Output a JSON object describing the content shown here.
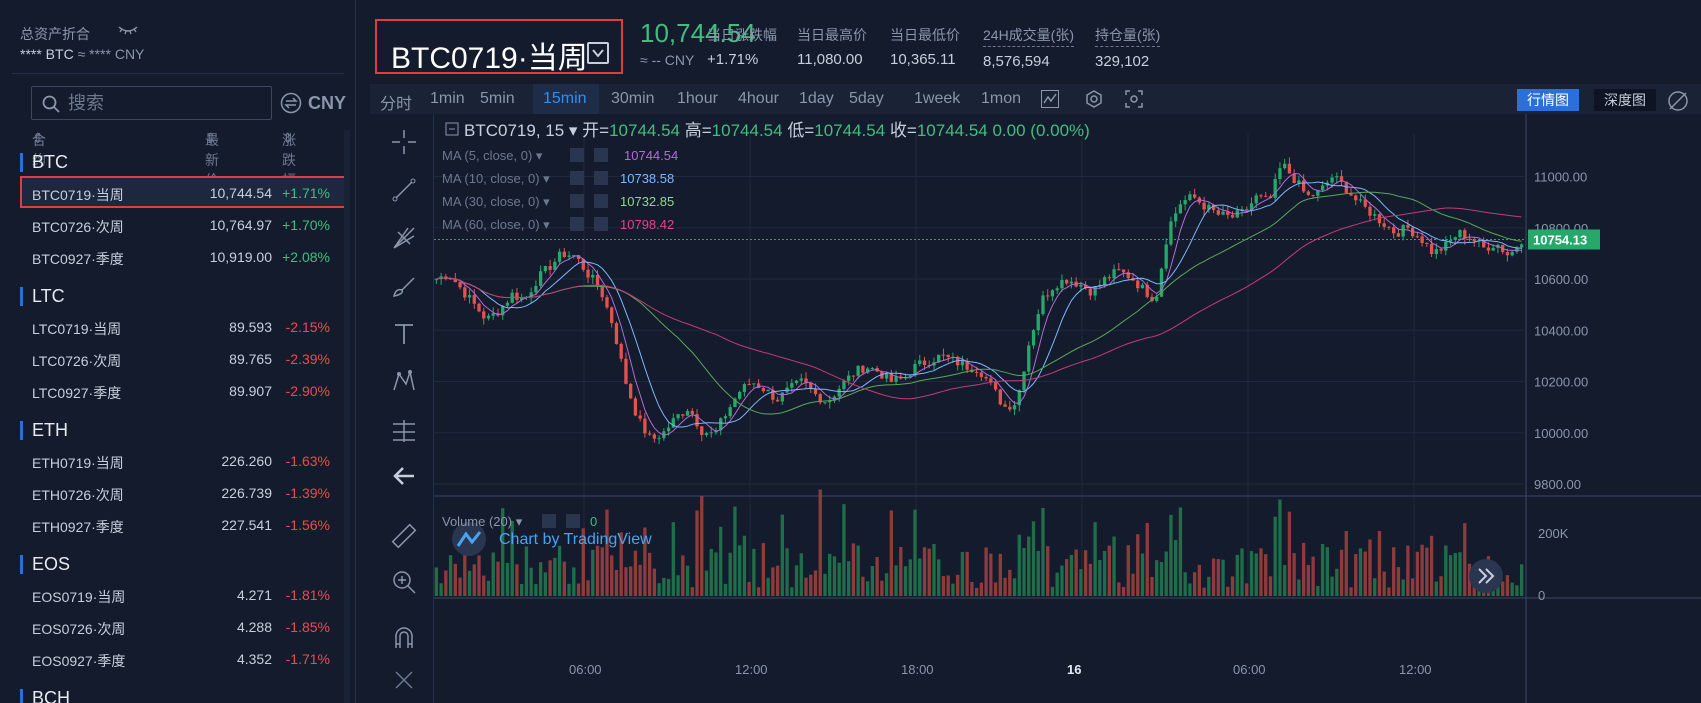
{
  "sidebar": {
    "asset_title": "总资产折合",
    "asset_btc": "**** BTC",
    "asset_cny": "≈ **** CNY",
    "search_placeholder": "搜索",
    "currency": "CNY",
    "col_contract": "合约",
    "col_price": "最新价",
    "col_change": "涨跌幅",
    "groups": [
      {
        "title": "BTC",
        "rows": [
          {
            "name": "BTC0719·当周",
            "price": "10,744.54",
            "change": "+1.71%",
            "dir": "up",
            "selected": true
          },
          {
            "name": "BTC0726·次周",
            "price": "10,764.97",
            "change": "+1.70%",
            "dir": "up"
          },
          {
            "name": "BTC0927·季度",
            "price": "10,919.00",
            "change": "+2.08%",
            "dir": "up"
          }
        ]
      },
      {
        "title": "LTC",
        "rows": [
          {
            "name": "LTC0719·当周",
            "price": "89.593",
            "change": "-2.15%",
            "dir": "down"
          },
          {
            "name": "LTC0726·次周",
            "price": "89.765",
            "change": "-2.39%",
            "dir": "down"
          },
          {
            "name": "LTC0927·季度",
            "price": "89.907",
            "change": "-2.90%",
            "dir": "down"
          }
        ]
      },
      {
        "title": "ETH",
        "rows": [
          {
            "name": "ETH0719·当周",
            "price": "226.260",
            "change": "-1.63%",
            "dir": "down"
          },
          {
            "name": "ETH0726·次周",
            "price": "226.739",
            "change": "-1.39%",
            "dir": "down"
          },
          {
            "name": "ETH0927·季度",
            "price": "227.541",
            "change": "-1.56%",
            "dir": "down"
          }
        ]
      },
      {
        "title": "EOS",
        "rows": [
          {
            "name": "EOS0719·当周",
            "price": "4.271",
            "change": "-1.81%",
            "dir": "down"
          },
          {
            "name": "EOS0726·次周",
            "price": "4.288",
            "change": "-1.85%",
            "dir": "down"
          },
          {
            "name": "EOS0927·季度",
            "price": "4.352",
            "change": "-1.71%",
            "dir": "down"
          }
        ]
      },
      {
        "title": "BCH",
        "rows": []
      }
    ]
  },
  "header": {
    "symbol": "BTC0719·当周",
    "last_price": "10,744.54",
    "last_cny": "≈ -- CNY",
    "stats": [
      {
        "key": "当日涨跌幅",
        "value": "+1.71%",
        "dir": "up"
      },
      {
        "key": "当日最高价",
        "value": "11,080.00"
      },
      {
        "key": "当日最低价",
        "value": "10,365.11"
      },
      {
        "key": "24H成交量(张)",
        "value": "8,576,594",
        "dashed": true
      },
      {
        "key": "持仓量(张)",
        "value": "329,102",
        "dashed": true
      }
    ]
  },
  "toolbar": {
    "timeframes": [
      "分时",
      "1min",
      "5min",
      "15min",
      "30min",
      "1hour",
      "4hour",
      "1day",
      "5day",
      "1week",
      "1mon"
    ],
    "active_timeframe": "15min",
    "market_btn": "行情图",
    "depth_btn": "深度图"
  },
  "chart": {
    "legend_symbol": "BTC0719, 15",
    "ohlc": {
      "open_label": "开=",
      "open": "10744.54",
      "high_label": "高=",
      "high": "10744.54",
      "low_label": "低=",
      "low": "10744.54",
      "close_label": "收=",
      "close": "10744.54",
      "change": "0.00 (0.00%)"
    },
    "ma_lines": [
      {
        "label": "MA (5, close, 0)",
        "value": "10744.54",
        "color": "#b36bd6"
      },
      {
        "label": "MA (10, close, 0)",
        "value": "10738.58",
        "color": "#7fb6ff"
      },
      {
        "label": "MA (30, close, 0)",
        "value": "10732.85",
        "color": "#8fd98f"
      },
      {
        "label": "MA (60, close, 0)",
        "value": "10798.42",
        "color": "#d6498a"
      }
    ],
    "watermark": "Chart by TradingView",
    "last_price_tag": "10754.13",
    "volume_label": "Volume (20)",
    "volume_value": "0",
    "y_ticks": [
      "11000.00",
      "10800.00",
      "10600.00",
      "10400.00",
      "10200.00",
      "10000.00",
      "9800.00"
    ],
    "vol_ticks": [
      "200K",
      "0"
    ],
    "x_ticks": [
      "06:00",
      "12:00",
      "18:00",
      "16",
      "06:00",
      "12:00"
    ]
  },
  "chart_data": {
    "type": "candlestick",
    "interval": "15min",
    "y_range": [
      9800,
      11080
    ],
    "x_labels": [
      "06:00",
      "12:00",
      "18:00",
      "16",
      "06:00",
      "12:00"
    ],
    "close_path": [
      10600,
      10620,
      10560,
      10500,
      10440,
      10480,
      10540,
      10520,
      10600,
      10650,
      10700,
      10690,
      10620,
      10560,
      10420,
      10200,
      10050,
      9970,
      10000,
      10060,
      10100,
      10010,
      9990,
      10080,
      10160,
      10200,
      10170,
      10130,
      10170,
      10200,
      10150,
      10120,
      10180,
      10230,
      10260,
      10240,
      10200,
      10210,
      10260,
      10280,
      10300,
      10280,
      10260,
      10250,
      10180,
      10100,
      10120,
      10360,
      10520,
      10580,
      10600,
      10580,
      10550,
      10600,
      10630,
      10610,
      10560,
      10520,
      10800,
      10900,
      10920,
      10880,
      10850,
      10840,
      10860,
      10920,
      10900,
      11050,
      10990,
      10920,
      10940,
      11000,
      10960,
      10900,
      10860,
      10820,
      10780,
      10800,
      10760,
      10700,
      10730,
      10780,
      10760,
      10720,
      10740,
      10690,
      10754
    ]
  }
}
